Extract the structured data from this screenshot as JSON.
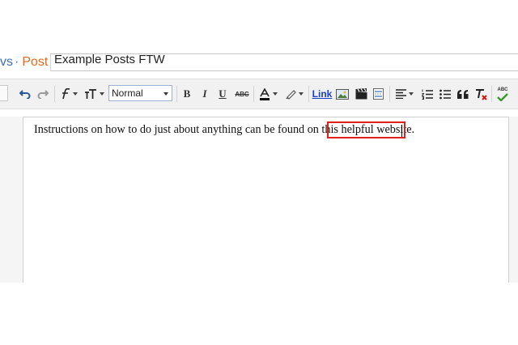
{
  "breadcrumb": {
    "prefix": "vs",
    "separator": "·",
    "section": "Post"
  },
  "post_title": {
    "value": "Example Posts FTW"
  },
  "toolbar": {
    "format_select": {
      "value": "Normal"
    },
    "bold": "B",
    "italic": "I",
    "underline": "U",
    "strikethrough": "ABC",
    "link": "Link",
    "spellcheck": "ABC"
  },
  "editor": {
    "text_before": "Instructions on how to do just about anything can be found on this ",
    "link_text": "helpful website."
  }
}
